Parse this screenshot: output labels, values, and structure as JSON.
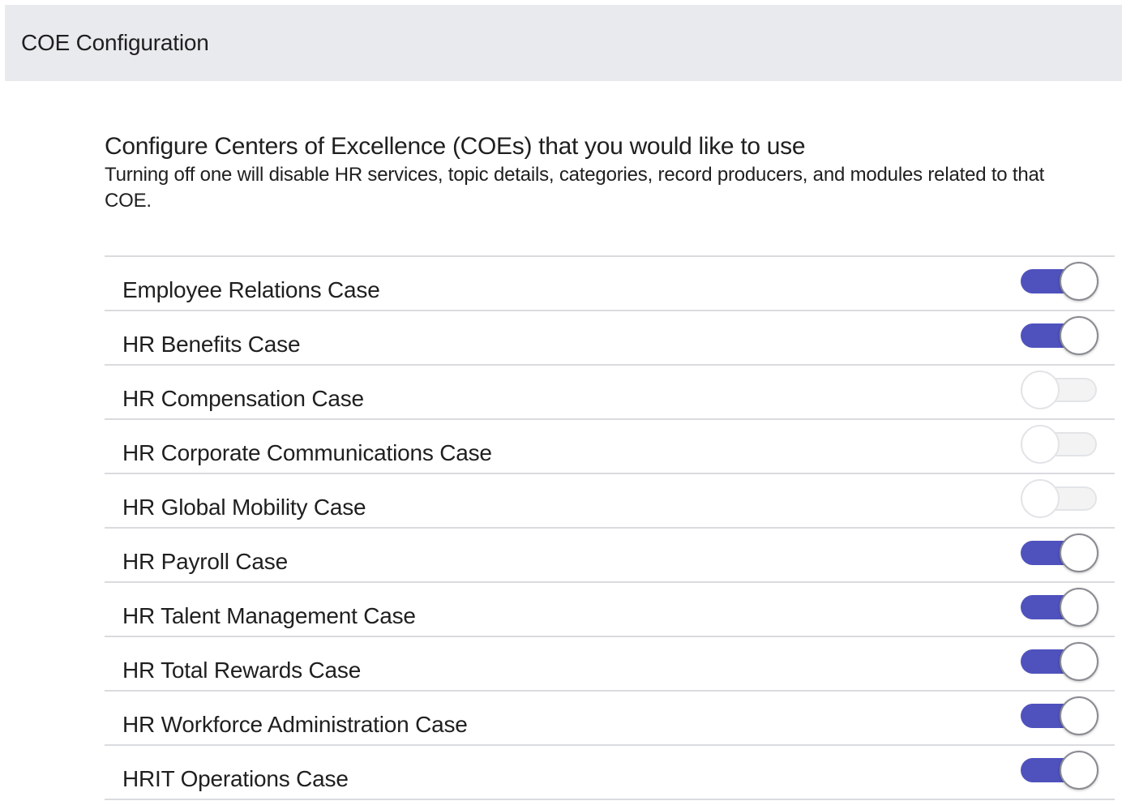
{
  "header": {
    "title": "COE Configuration"
  },
  "intro": {
    "heading": "Configure Centers of Excellence (COEs) that you would like to use",
    "description": "Turning off one will disable HR services, topic details, categories, record producers, and modules related to that COE."
  },
  "colors": {
    "toggle_on": "#4f52bd",
    "toggle_off": "#f3f3f4",
    "header_bg": "#e9eaee"
  },
  "coes": [
    {
      "label": "Employee Relations Case",
      "enabled": true
    },
    {
      "label": "HR Benefits Case",
      "enabled": true
    },
    {
      "label": "HR Compensation Case",
      "enabled": false
    },
    {
      "label": "HR Corporate Communications Case",
      "enabled": false
    },
    {
      "label": "HR Global Mobility Case",
      "enabled": false
    },
    {
      "label": "HR Payroll Case",
      "enabled": true
    },
    {
      "label": "HR Talent Management Case",
      "enabled": true
    },
    {
      "label": "HR Total Rewards Case",
      "enabled": true
    },
    {
      "label": "HR Workforce Administration Case",
      "enabled": true
    },
    {
      "label": "HRIT Operations Case",
      "enabled": true
    }
  ]
}
